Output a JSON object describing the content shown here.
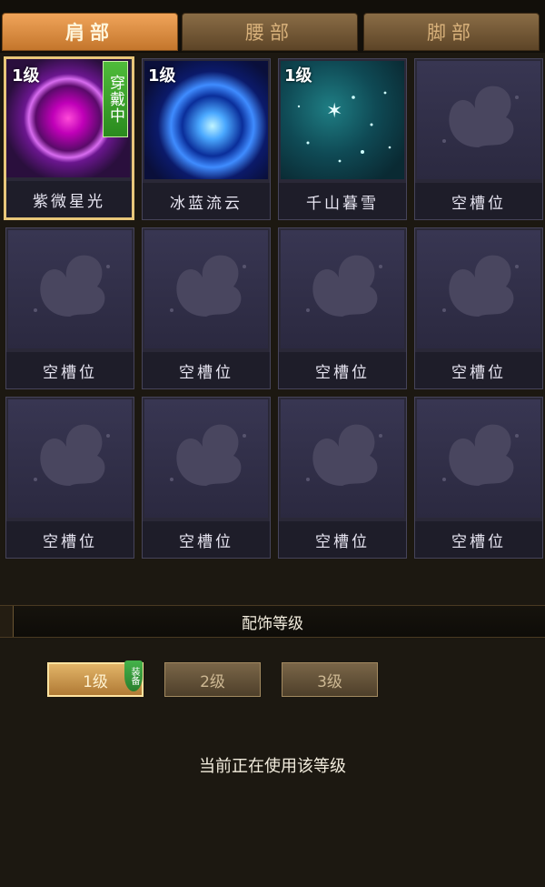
{
  "tabs": [
    {
      "label": "肩部",
      "active": true
    },
    {
      "label": "腰部",
      "active": false
    },
    {
      "label": "脚部",
      "active": false
    }
  ],
  "slots": [
    {
      "name": "紫微星光",
      "level": "1级",
      "wearing": "穿戴中",
      "art": "purple-orb-icon",
      "selected": true
    },
    {
      "name": "冰蓝流云",
      "level": "1级",
      "art": "blue-swirl-icon"
    },
    {
      "name": "千山暮雪",
      "level": "1级",
      "art": "teal-snow-icon"
    },
    {
      "name": "空槽位",
      "art": "butterfly-icon"
    },
    {
      "name": "空槽位",
      "art": "butterfly-icon"
    },
    {
      "name": "空槽位",
      "art": "butterfly-icon"
    },
    {
      "name": "空槽位",
      "art": "butterfly-icon"
    },
    {
      "name": "空槽位",
      "art": "butterfly-icon"
    },
    {
      "name": "空槽位",
      "art": "butterfly-icon"
    },
    {
      "name": "空槽位",
      "art": "butterfly-icon"
    },
    {
      "name": "空槽位",
      "art": "butterfly-icon"
    },
    {
      "name": "空槽位",
      "art": "butterfly-icon"
    }
  ],
  "section_title": "配饰等级",
  "levels": [
    {
      "label": "1级",
      "active": true,
      "tag": "装备"
    },
    {
      "label": "2级",
      "active": false
    },
    {
      "label": "3级",
      "active": false
    }
  ],
  "status_text": "当前正在使用该等级"
}
